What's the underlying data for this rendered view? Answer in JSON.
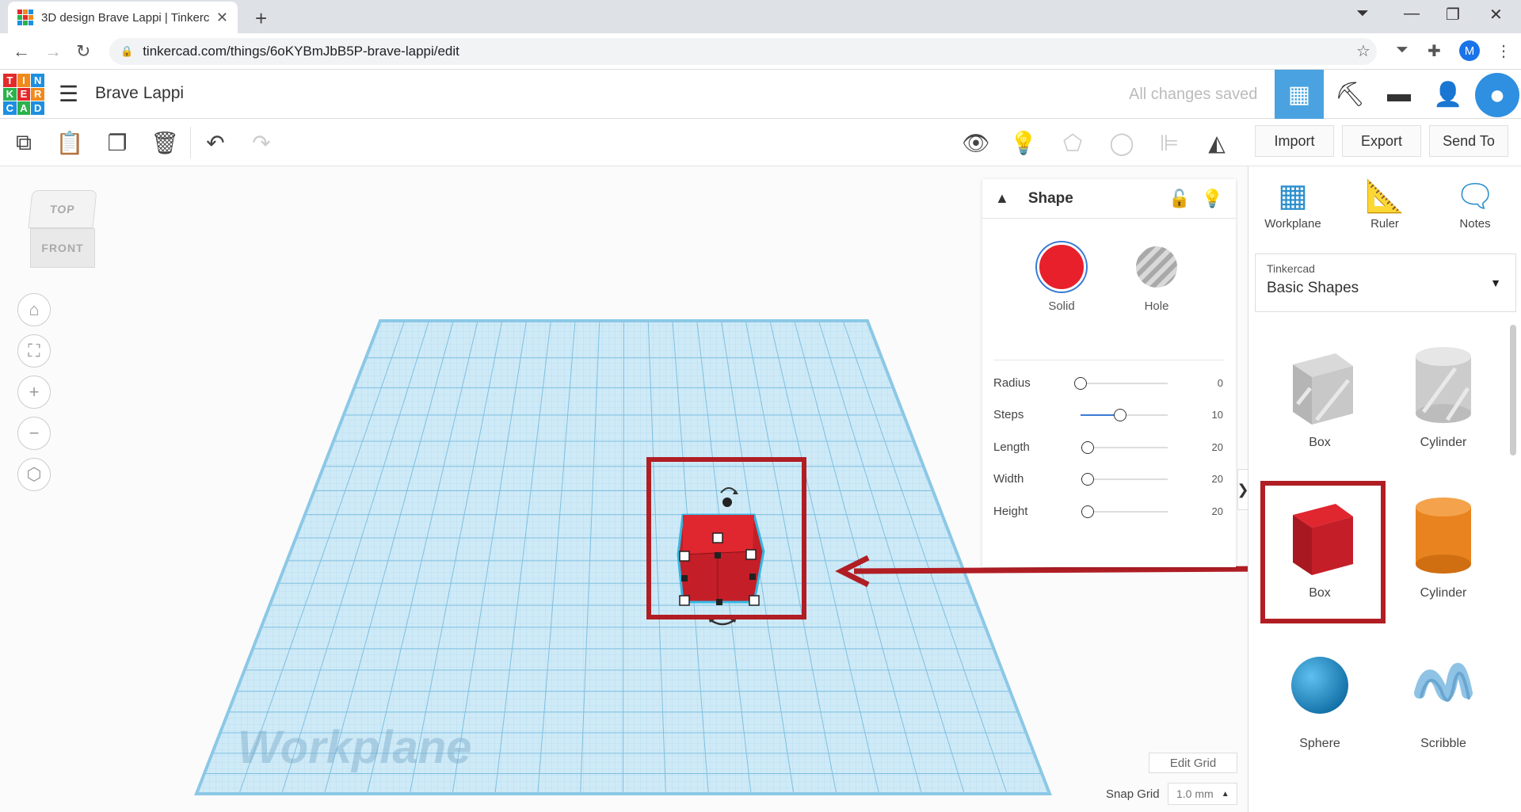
{
  "browser": {
    "tab_title": "3D design Brave Lappi | Tinkercad",
    "new_tab": "+",
    "url": "tinkercad.com/things/6oKYBmJbB5P-brave-lappi/edit",
    "profile_letter": "M"
  },
  "app": {
    "logo_letters": [
      "T",
      "I",
      "N",
      "K",
      "E",
      "R",
      "C",
      "A",
      "D"
    ],
    "logo_colors": [
      "#e32a2a",
      "#f08a1d",
      "#1d8fe0",
      "#2bb24c",
      "#e32a2a",
      "#f08a1d",
      "#1d8fe0",
      "#2bb24c",
      "#1d8fe0"
    ],
    "design_title": "Brave Lappi",
    "save_status": "All changes saved"
  },
  "toolbar": {
    "import_label": "Import",
    "export_label": "Export",
    "send_to_label": "Send To"
  },
  "viewcube": {
    "top": "TOP",
    "front": "FRONT"
  },
  "workplane": {
    "label": "Workplane",
    "edit_grid_label": "Edit Grid",
    "snap_grid_label": "Snap Grid",
    "snap_grid_value": "1.0 mm"
  },
  "inspector": {
    "title": "Shape",
    "solid_label": "Solid",
    "hole_label": "Hole",
    "solid_color": "#e8202b",
    "params": [
      {
        "name": "Radius",
        "value": "0",
        "fraction": 0.0
      },
      {
        "name": "Steps",
        "value": "10",
        "fraction": 0.45
      },
      {
        "name": "Length",
        "value": "20",
        "fraction": 0.08
      },
      {
        "name": "Width",
        "value": "20",
        "fraction": 0.08
      },
      {
        "name": "Height",
        "value": "20",
        "fraction": 0.08
      }
    ]
  },
  "right_panel": {
    "tools": [
      "Workplane",
      "Ruler",
      "Notes"
    ],
    "library_category": "Tinkercad",
    "library_name": "Basic Shapes",
    "shapes": [
      "Box",
      "Cylinder",
      "Box",
      "Cylinder",
      "Sphere",
      "Scribble"
    ]
  },
  "colors": {
    "highlight": "#b01e24",
    "accent": "#4aa3e0",
    "box_red": "#d11f2a",
    "cylinder_orange": "#e8831f",
    "sphere_blue": "#1e8ecf",
    "scribble_blue": "#8fc3e6"
  }
}
